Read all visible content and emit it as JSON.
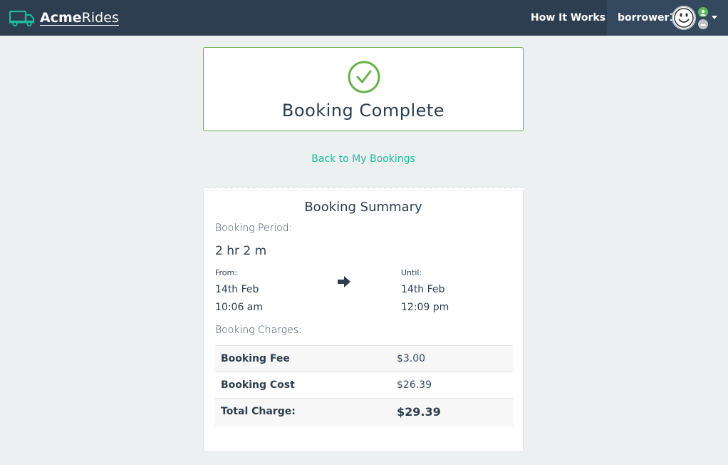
{
  "navbar": {
    "brand_bold": "Acme",
    "brand_light": "Rides",
    "how_it_works": "How It Works",
    "username": "borrower1"
  },
  "complete": {
    "title": "Booking Complete"
  },
  "back_link": "Back to My Bookings",
  "summary": {
    "title": "Booking Summary",
    "period_label": "Booking Period:",
    "period_value": "2 hr 2 m",
    "from_label": "From:",
    "from_date": "14th Feb",
    "from_time": "10:06 am",
    "until_label": "Until:",
    "until_date": "14th Feb",
    "until_time": "12:09 pm",
    "charges_label": "Booking Charges:",
    "charges": [
      {
        "name": "Booking Fee",
        "value": "$3.00"
      },
      {
        "name": "Booking Cost",
        "value": "$26.39"
      },
      {
        "name": "Total Charge:",
        "value": "$29.39"
      }
    ]
  },
  "colors": {
    "navbar": "#2c3e50",
    "accent": "#1abc9c",
    "success": "#6ab04c"
  },
  "icons": [
    "truck-icon",
    "check-circle-icon",
    "arrow-right-icon",
    "avatar-icon",
    "chevron-down-icon"
  ]
}
